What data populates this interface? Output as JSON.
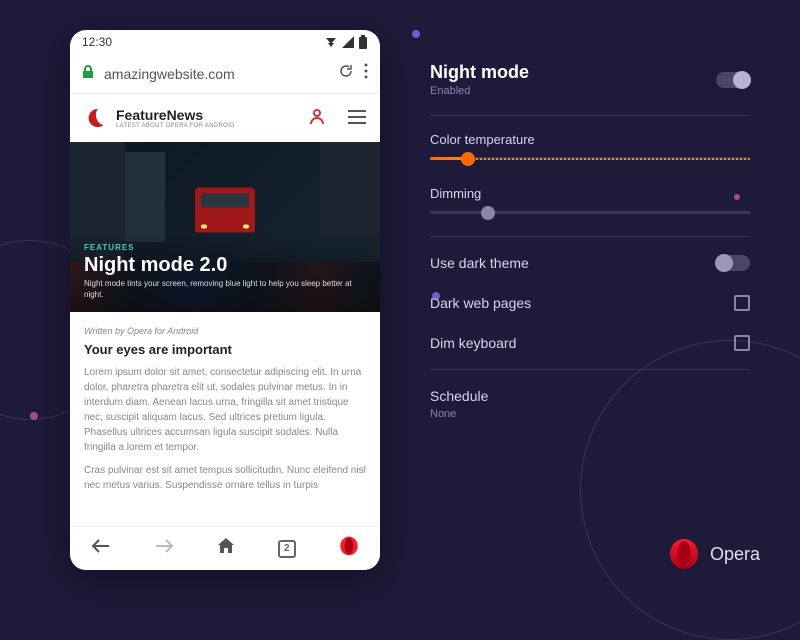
{
  "phone": {
    "status": {
      "time": "12:30"
    },
    "url": "amazingwebsite.com",
    "site": {
      "name": "FeatureNews",
      "tagline": "LATEST ABOUT OPERA FOR ANDROID"
    },
    "hero": {
      "kicker": "FEATURES",
      "title": "Night mode 2.0",
      "description": "Night mode tints your screen, removing blue light to help you sleep better at night."
    },
    "article": {
      "byline": "Written by Opera for Android",
      "title": "Your eyes are important",
      "p1": "Lorem ipsum dolor sit amet, consectetur adipiscing elit. In urna dolor, pharetra pharetra elit ut, sodales pulvinar metus. In in interdum diam. Aenean lacus urna, fringilla sit amet tristique nec, suscipit aliquam lacus. Sed ultrices pretium ligula. Phasellus ultrices accumsan ligula suscipit sodales. Nulla fringilla a lorem et tempor.",
      "p2": "Cras pulvinar est sit amet tempus sollicitudin. Nunc eleifend nisl nec metus varius. Suspendisse ornare tellus in turpis"
    },
    "nav": {
      "tab_count": "2"
    }
  },
  "settings": {
    "night_mode": {
      "title": "Night mode",
      "status": "Enabled",
      "enabled": true
    },
    "color_temp": {
      "label": "Color temperature",
      "value": 12
    },
    "dimming": {
      "label": "Dimming",
      "value": 18
    },
    "dark_theme": {
      "label": "Use dark theme",
      "enabled": false
    },
    "dark_pages": {
      "label": "Dark web pages",
      "checked": false
    },
    "dim_keyboard": {
      "label": "Dim keyboard",
      "checked": false
    },
    "schedule": {
      "label": "Schedule",
      "value": "None"
    }
  },
  "brand": {
    "name": "Opera"
  }
}
